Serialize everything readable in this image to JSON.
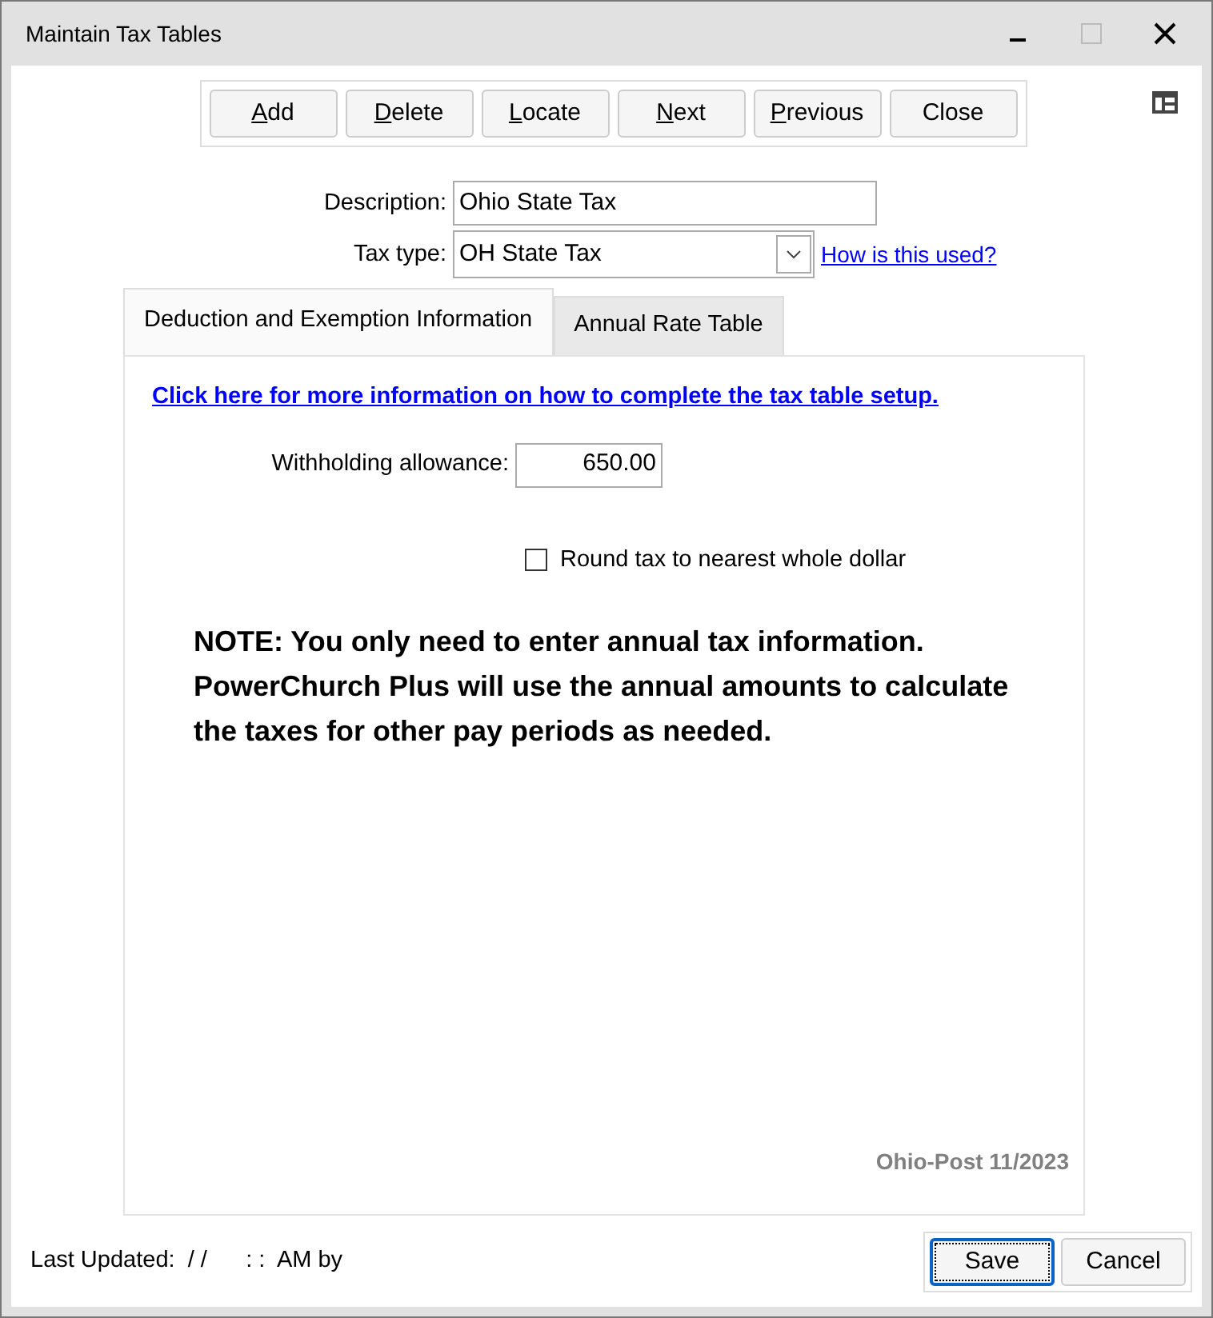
{
  "window": {
    "title": "Maintain Tax Tables"
  },
  "toolbar": [
    {
      "label": "Add",
      "underline_first": true
    },
    {
      "label": "Delete",
      "underline_first": true
    },
    {
      "label": "Locate",
      "underline_first": true
    },
    {
      "label": "Next",
      "underline_first": true
    },
    {
      "label": "Previous",
      "underline_first": true
    },
    {
      "label": "Close",
      "underline_first": false
    }
  ],
  "description": {
    "label": "Description:",
    "value": "Ohio State Tax"
  },
  "tax_type": {
    "label": "Tax type:",
    "value": "OH State Tax",
    "link": "How is this used?"
  },
  "tabs": [
    {
      "label": "Deduction and Exemption Information",
      "selected": true
    },
    {
      "label": "Annual Rate Table",
      "selected": false
    }
  ],
  "panel": {
    "info_link": "Click here for more information on how to complete the tax table setup.",
    "allowance": {
      "label": "Withholding allowance:",
      "value": "650.00"
    },
    "round_checkbox": {
      "label": "Round tax to nearest whole dollar",
      "checked": false
    },
    "note": "NOTE: You only need to enter annual tax information. PowerChurch Plus will use the annual amounts to calculate the taxes for other pay periods as needed.",
    "version": "Ohio-Post 11/2023"
  },
  "last_updated": "Last Updated:  / /      : :  AM by",
  "buttons": [
    {
      "label": "Save",
      "default": true
    },
    {
      "label": "Cancel",
      "default": false
    }
  ]
}
